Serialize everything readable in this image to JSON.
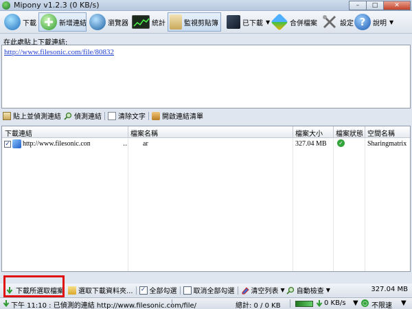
{
  "window": {
    "title": "Mipony v1.2.3 (0 KB/s)",
    "minimize": "–",
    "maximize": "□",
    "close": "✕"
  },
  "toolbar": {
    "download": "下載",
    "add_link": "新增連結",
    "browser": "瀏覽器",
    "stats": "統計",
    "monitor_clipboard": "監視剪貼簿",
    "downloaded": "已下載",
    "merge_files": "合併檔案",
    "settings": "設定",
    "help": "說明"
  },
  "paste_area": {
    "label": "在此處貼上下載連結:",
    "url": "http://www.filesonic.com/file/80832"
  },
  "subbar": {
    "paste_detect": "貼上並偵測連結",
    "detect": "偵測連結",
    "clear_text": "清除文字",
    "open_link_list": "開啟連結清單"
  },
  "table": {
    "headers": [
      "下載連結",
      "檔案名稱",
      "檔案大小",
      "檔案狀態",
      "空間名稱"
    ],
    "rows": [
      {
        "link": "http://www.filesonic.com/file",
        "ellipsis": "..",
        "filename": "ar",
        "size": "327.04 MB",
        "server": "Sharingmatrix"
      }
    ]
  },
  "actions": {
    "download_selected": "下載所選取檔案",
    "choose_folder": "選取下載資料夾...",
    "select_all": "全部勾選",
    "deselect_all": "取消全部勾選",
    "clear_list": "清空列表",
    "auto_check": "自動檢查",
    "total": "327.04 MB"
  },
  "status": {
    "message": "下午 11:10 : 已偵測的連結 http://www.filesonic.com/file/",
    "total": "總計: 0 / 0 KB",
    "speed": "0 KB/s",
    "limit": "不限速"
  }
}
